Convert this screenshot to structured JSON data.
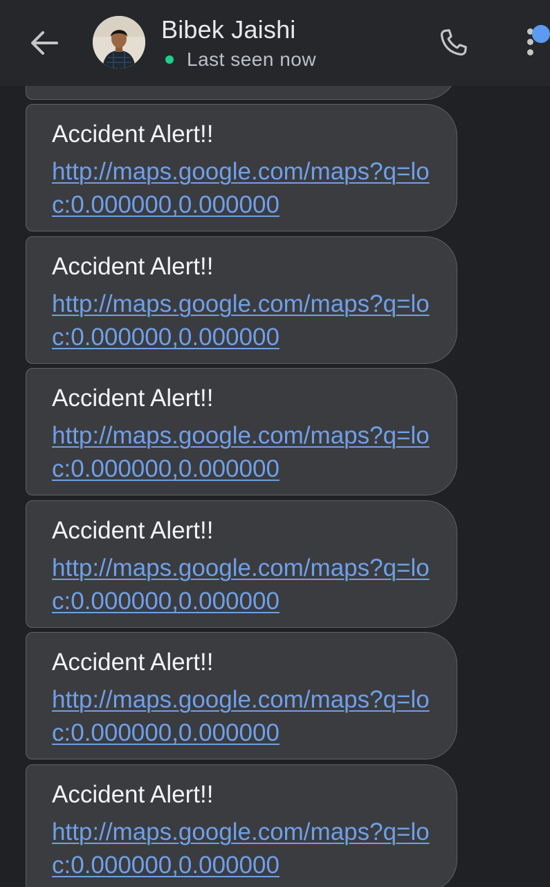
{
  "header": {
    "contact_name": "Bibek Jaishi",
    "status": "Last seen now",
    "icons": {
      "back": "arrow-left-icon",
      "call": "phone-icon",
      "more": "more-vert-icon"
    }
  },
  "colors": {
    "background": "#202124",
    "header_bg": "#26272b",
    "bubble_bg": "#3b3c40",
    "link": "#6fa0e8",
    "online": "#1ecf8e",
    "badge": "#5b9bf1"
  },
  "messages": [
    {
      "title": "Accident Alert!!",
      "link": "http://maps.google.com/maps?q=loc:0.000000,0.000000"
    },
    {
      "title": "Accident Alert!!",
      "link": "http://maps.google.com/maps?q=loc:0.000000,0.000000"
    },
    {
      "title": "Accident Alert!!",
      "link": "http://maps.google.com/maps?q=loc:0.000000,0.000000"
    },
    {
      "title": "Accident Alert!!",
      "link": "http://maps.google.com/maps?q=loc:0.000000,0.000000"
    },
    {
      "title": "Accident Alert!!",
      "link": "http://maps.google.com/maps?q=loc:0.000000,0.000000"
    },
    {
      "title": "Accident Alert!!",
      "link": "http://maps.google.com/maps?q=loc:0.000000,0.000000"
    }
  ]
}
